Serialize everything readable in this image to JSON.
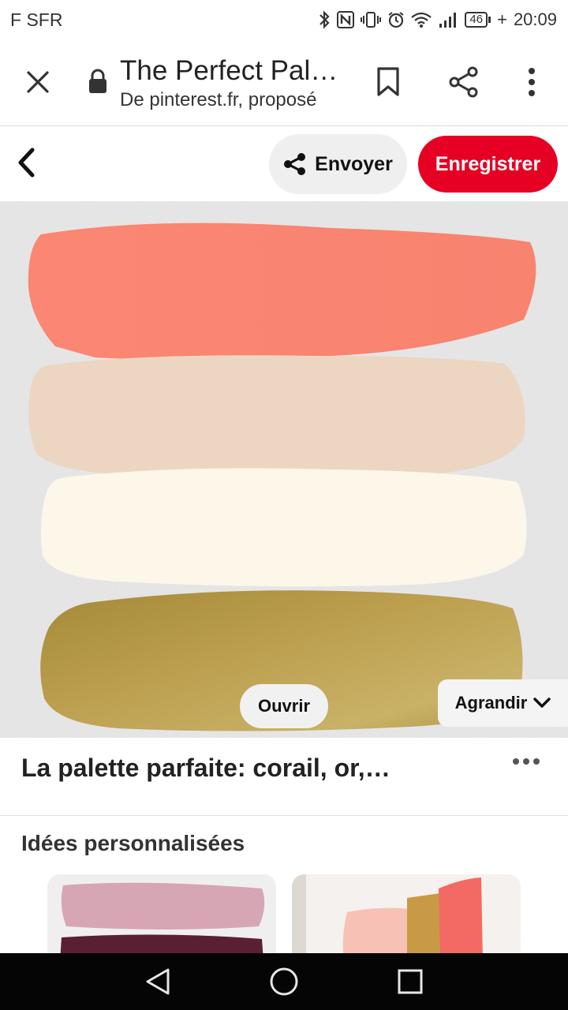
{
  "status_bar": {
    "carrier": "F SFR",
    "battery": "46",
    "charge_mark": "+",
    "time": "20:09"
  },
  "tab_header": {
    "title": "The Perfect Pal…",
    "subtitle": "De pinterest.fr, proposé"
  },
  "actions": {
    "send_label": "Envoyer",
    "save_label": "Enregistrer"
  },
  "image_overlay": {
    "open_label": "Ouvrir",
    "expand_label": "Agrandir"
  },
  "pin": {
    "title": "La palette parfaite: corail, or,…"
  },
  "ideas": {
    "heading": "Idées personnalisées"
  },
  "colors": {
    "brand_red": "#e60023",
    "swatch_coral": "#f98573",
    "swatch_beige": "#ecd7c2",
    "swatch_cream": "#fbf6e8",
    "swatch_gold": "#c4a24a"
  }
}
